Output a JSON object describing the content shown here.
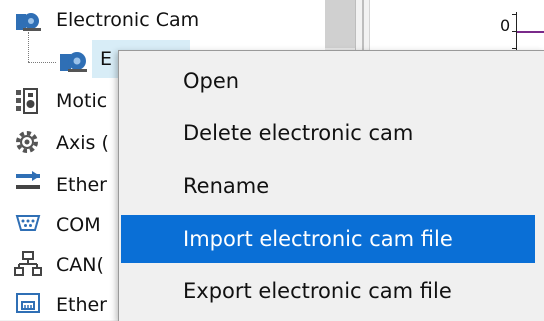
{
  "tree": {
    "items": [
      {
        "label": "Electronic Cam",
        "icon": "cam-icon"
      },
      {
        "label": "E",
        "icon": "cam-icon",
        "selected": true
      },
      {
        "label": "Motic",
        "icon": "motion-icon"
      },
      {
        "label": "Axis (",
        "icon": "gear-icon"
      },
      {
        "label": "Ether",
        "icon": "ethercat-icon"
      },
      {
        "label": "COM",
        "icon": "com-port-icon"
      },
      {
        "label": "CAN(",
        "icon": "network-icon"
      },
      {
        "label": "Ether",
        "icon": "ethernet-icon"
      }
    ]
  },
  "chart": {
    "axis_label": "0"
  },
  "context_menu": {
    "items": [
      {
        "label": "Open"
      },
      {
        "label": "Delete electronic cam"
      },
      {
        "label": "Rename"
      },
      {
        "label": "Import electronic cam file",
        "highlighted": true
      },
      {
        "label": "Export electronic cam file"
      }
    ]
  },
  "colors": {
    "highlight": "#0a6fd6",
    "selection": "#d8edf7",
    "series": "#7a2a8a",
    "icon_blue": "#2f6fb5"
  }
}
